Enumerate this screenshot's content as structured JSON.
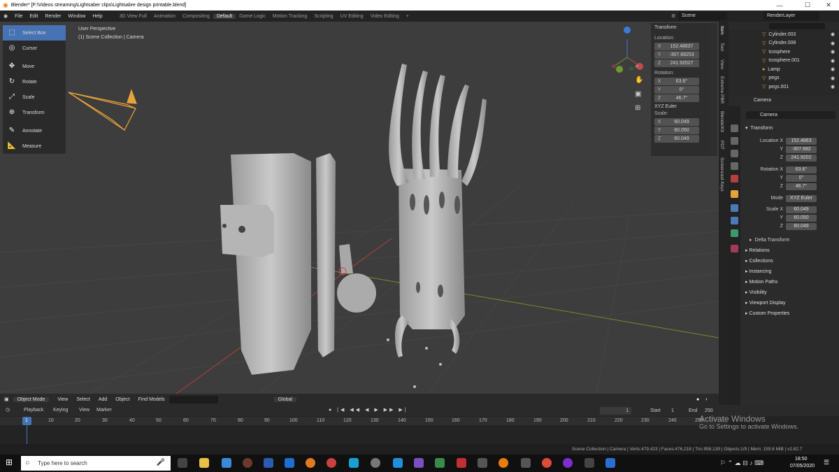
{
  "window": {
    "title": "Blender* [F:\\Videos streaming\\Lightsaber clips\\Lightsabre design printable.blend]",
    "minimize": "—",
    "maximize": "☐",
    "close": "✕"
  },
  "menu": {
    "items": [
      "File",
      "Edit",
      "Render",
      "Window",
      "Help"
    ],
    "workspaces": [
      "3D View Full",
      "Animation",
      "Compositing",
      "Default",
      "Game Logic",
      "Motion Tracking",
      "Scripting",
      "UV Editing",
      "Video Editing"
    ],
    "active_workspace": "Default",
    "add_tab": "+",
    "scene": "Scene",
    "view_layer": "RenderLayer"
  },
  "tools": [
    "Select Box",
    "Cursor",
    "Move",
    "Rotate",
    "Scale",
    "Transform",
    "Annotate",
    "Measure"
  ],
  "viewport": {
    "perspective": "User Perspective",
    "collection": "(1) Scene Collection | Camera",
    "mode": "Object Mode",
    "menus": [
      "View",
      "Select",
      "Add",
      "Object"
    ],
    "find": "Find Models",
    "orientation": "Global"
  },
  "npanel": {
    "title": "Transform",
    "location_label": "Location:",
    "loc": [
      "152.48637",
      "-307.68253",
      "241.92027"
    ],
    "rotation_label": "Rotation:",
    "rot": [
      "63.6°",
      "0°",
      "46.7°"
    ],
    "euler": "XYZ Euler",
    "scale_label": "Scale:",
    "scale": [
      "60.049",
      "60.050",
      "60.049"
    ],
    "axes": [
      "X",
      "Y",
      "Z"
    ]
  },
  "sidetabs": [
    "Item",
    "Tool",
    "View",
    "Extreme PBR",
    "BlenderKit",
    "PDT",
    "Screencast Keys"
  ],
  "outliner": {
    "rows": [
      "Cylinder.003",
      "Cylinder.008",
      "tcosphere",
      "tcosphere.001",
      "Lamp",
      "pegs",
      "pegs.001"
    ]
  },
  "properties": {
    "object": "Camera",
    "name_field": "Camera",
    "transform": "Transform",
    "location_label": "Location X",
    "loc": [
      "152.4863",
      "-307.682",
      "241.9202"
    ],
    "rotation_label": "Rotation X",
    "rot": [
      "63.6°",
      "0°",
      "46.7°"
    ],
    "mode_label": "Mode",
    "mode": "XYZ Euler",
    "scale_label": "Scale X",
    "scale": [
      "60.049",
      "60.050",
      "60.049"
    ],
    "yz": [
      "Y",
      "Z"
    ],
    "delta": "Delta Transform",
    "sections": [
      "Relations",
      "Collections",
      "Instancing",
      "Motion Paths",
      "Visibility",
      "Viewport Display",
      "Custom Properties"
    ]
  },
  "timeline": {
    "menus": [
      "Playback",
      "Keying",
      "View",
      "Marker"
    ],
    "current_frame": "1",
    "start_label": "Start",
    "start": "1",
    "end_label": "End",
    "end": "250",
    "ticks": [
      "1",
      "10",
      "20",
      "30",
      "40",
      "50",
      "60",
      "70",
      "80",
      "90",
      "100",
      "110",
      "120",
      "130",
      "140",
      "150",
      "160",
      "170",
      "180",
      "190",
      "200",
      "210",
      "220",
      "230",
      "240",
      "250"
    ]
  },
  "status": {
    "text": "Scene Collection | Camera | Verts:479,423 | Faces:476,218 | Tris:958,139 | Objects:1/9 | Mem: 159.8 MiB | v2.82.7"
  },
  "watermark": {
    "line1": "Activate Windows",
    "line2": "Go to Settings to activate Windows."
  },
  "taskbar": {
    "search": "Type here to search",
    "time": "18:50",
    "date": "07/05/2020"
  }
}
